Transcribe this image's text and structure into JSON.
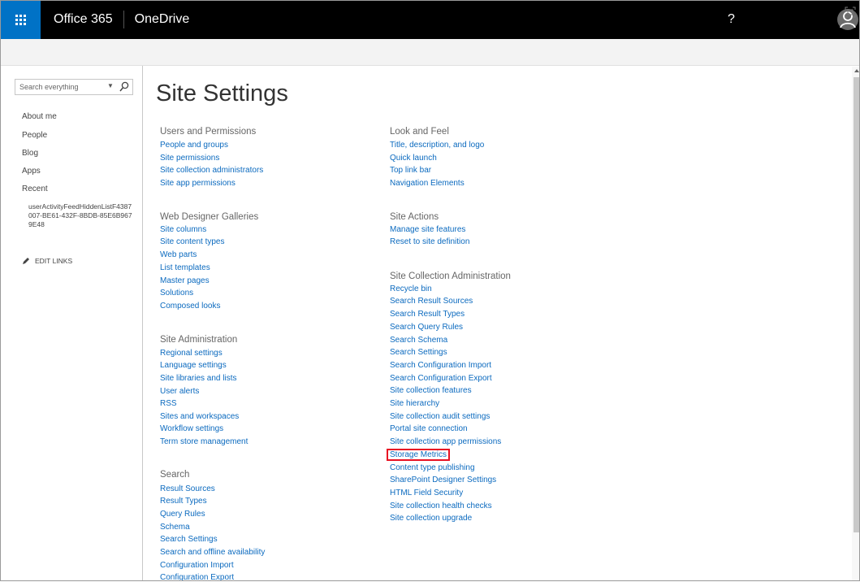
{
  "suitebar": {
    "brand": "Office 365",
    "app": "OneDrive",
    "help": "?"
  },
  "leftnav": {
    "search_placeholder": "Search everything",
    "dropdown": "▼",
    "items": [
      "About me",
      "People",
      "Blog",
      "Apps",
      "Recent"
    ],
    "recent_item": "userActivityFeedHiddenListF4387007-BE61-432F-8BDB-85E6B9679E48",
    "edit_links": "EDIT LINKS"
  },
  "page_title": "Site Settings",
  "sections": {
    "users": {
      "title": "Users and Permissions",
      "links": [
        "People and groups",
        "Site permissions",
        "Site collection administrators",
        "Site app permissions"
      ]
    },
    "webdesigner": {
      "title": "Web Designer Galleries",
      "links": [
        "Site columns",
        "Site content types",
        "Web parts",
        "List templates",
        "Master pages",
        "Solutions",
        "Composed looks"
      ]
    },
    "siteadmin": {
      "title": "Site Administration",
      "links": [
        "Regional settings",
        "Language settings",
        "Site libraries and lists",
        "User alerts",
        "RSS",
        "Sites and workspaces",
        "Workflow settings",
        "Term store management"
      ]
    },
    "search": {
      "title": "Search",
      "links": [
        "Result Sources",
        "Result Types",
        "Query Rules",
        "Schema",
        "Search Settings",
        "Search and offline availability",
        "Configuration Import",
        "Configuration Export"
      ]
    },
    "lookfeel": {
      "title": "Look and Feel",
      "links": [
        "Title, description, and logo",
        "Quick launch",
        "Top link bar",
        "Navigation Elements"
      ]
    },
    "siteactions": {
      "title": "Site Actions",
      "links": [
        "Manage site features",
        "Reset to site definition"
      ]
    },
    "sitecollection": {
      "title": "Site Collection Administration",
      "links": [
        "Recycle bin",
        "Search Result Sources",
        "Search Result Types",
        "Search Query Rules",
        "Search Schema",
        "Search Settings",
        "Search Configuration Import",
        "Search Configuration Export",
        "Site collection features",
        "Site hierarchy",
        "Site collection audit settings",
        "Portal site connection",
        "Site collection app permissions",
        "Storage Metrics",
        "Content type publishing",
        "SharePoint Designer Settings",
        "HTML Field Security",
        "Site collection health checks",
        "Site collection upgrade"
      ]
    }
  },
  "colors": {
    "suite_bar": "#000000",
    "waffle": "#0072c6",
    "link": "#0b6abf",
    "highlight": "#e81123"
  }
}
